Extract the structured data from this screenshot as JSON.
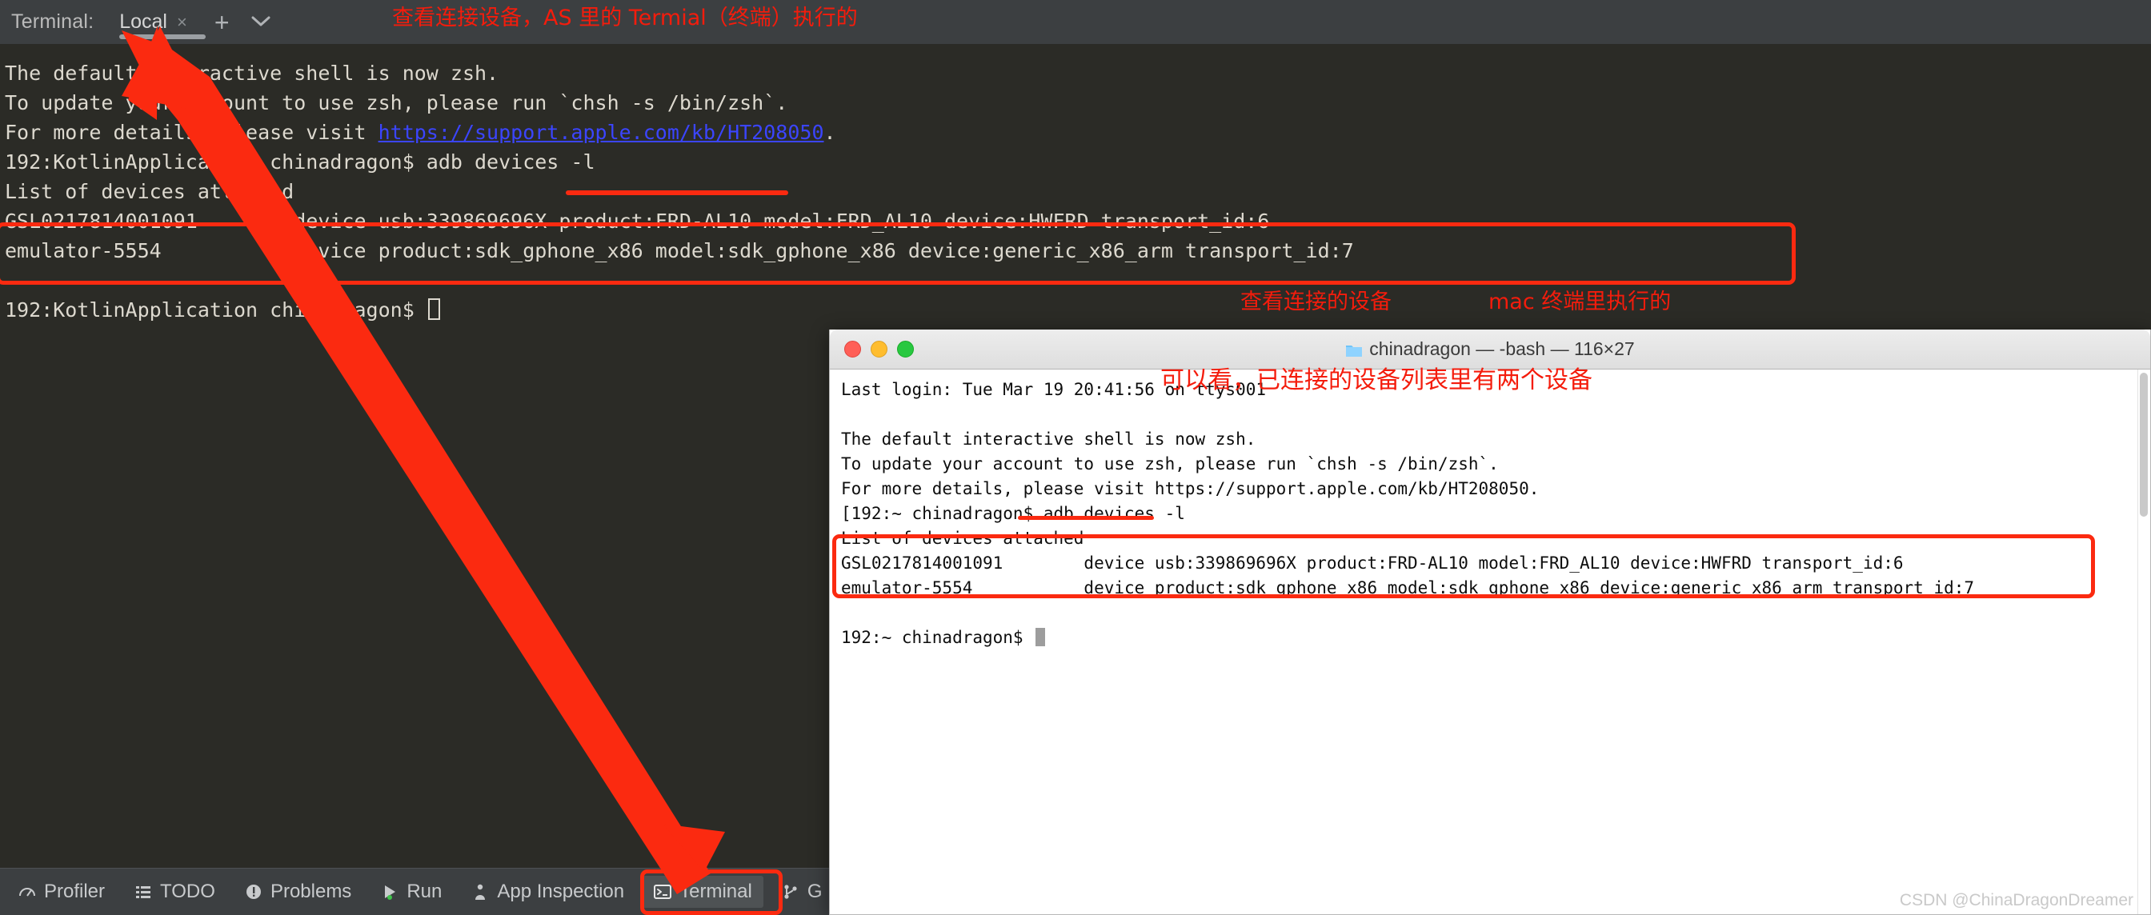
{
  "ide": {
    "terminal_tabbar": {
      "label": "Terminal:",
      "tab_name": "Local",
      "close_glyph": "×",
      "add_glyph": "+",
      "chevron_glyph": "⌄"
    },
    "console_lines": [
      "The default interactive shell is now zsh.",
      "To update your account to use zsh, please run `chsh -s /bin/zsh`.",
      "For more details, please visit ",
      "192:KotlinApplication chinadragon$ adb devices -l",
      "List of devices attached",
      "GSL0217814001091        device usb:339869696X product:FRD-AL10 model:FRD_AL10 device:HWFRD transport_id:6",
      "emulator-5554           device product:sdk_gphone_x86 model:sdk_gphone_x86 device:generic_x86_arm transport_id:7",
      "192:KotlinApplication chinadragon$ "
    ],
    "console_link": "https://support.apple.com/kb/HT208050",
    "console_link_tail": ".",
    "statusbar": [
      {
        "label": "Profiler",
        "icon": "profiler-icon",
        "active": false
      },
      {
        "label": "TODO",
        "icon": "todo-icon",
        "active": false
      },
      {
        "label": "Problems",
        "icon": "problems-icon",
        "active": false
      },
      {
        "label": "Run",
        "icon": "run-icon",
        "active": false
      },
      {
        "label": "App Inspection",
        "icon": "app-inspection-icon",
        "active": false
      },
      {
        "label": "Terminal",
        "icon": "terminal-icon",
        "active": true
      },
      {
        "label": "G",
        "icon": "git-branch-icon",
        "active": false
      }
    ]
  },
  "annotations": {
    "top_note": "查看连接设备，AS 里的 Termial（终端）执行的",
    "mac_note_1": "查看连接的设备",
    "mac_note_2": "mac 终端里执行的",
    "mac_note_3": "可以看，已连接的设备列表里有两个设备",
    "red_color": "#fb2a10"
  },
  "mac_terminal": {
    "title": "chinadragon — -bash — 116×27",
    "lines": [
      "Last login: Tue Mar 19 20:41:56 on ttys001",
      "",
      "The default interactive shell is now zsh.",
      "To update your account to use zsh, please run `chsh -s /bin/zsh`.",
      "For more details, please visit https://support.apple.com/kb/HT208050.",
      "[192:~ chinadragon$ adb devices -l",
      "List of devices attached",
      "GSL0217814001091        device usb:339869696X product:FRD-AL10 model:FRD_AL10 device:HWFRD transport_id:6",
      "emulator-5554           device product:sdk_gphone_x86 model:sdk_gphone_x86 device:generic_x86_arm transport_id:7",
      "",
      "192:~ chinadragon$ "
    ]
  },
  "watermark": "CSDN @ChinaDragonDreamer"
}
